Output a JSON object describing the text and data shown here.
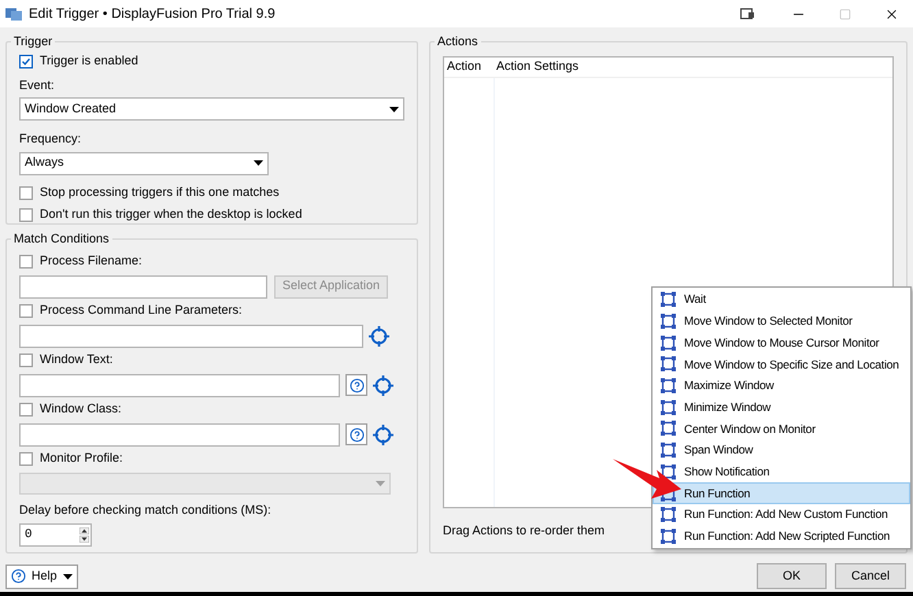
{
  "window": {
    "title": "Edit Trigger • DisplayFusion Pro Trial 9.9"
  },
  "trigger": {
    "legend": "Trigger",
    "enabled": {
      "label": "Trigger is enabled",
      "checked": true
    },
    "event_label": "Event:",
    "event_value": "Window Created",
    "frequency_label": "Frequency:",
    "frequency_value": "Always",
    "options": [
      {
        "label": "Stop processing triggers if this one matches",
        "checked": false
      },
      {
        "label": "Don't run this trigger when the desktop is locked",
        "checked": false
      }
    ]
  },
  "match": {
    "legend": "Match Conditions",
    "conditions": [
      {
        "label": "Process Filename:",
        "checked": false,
        "kind": "app",
        "button": "Select Application"
      },
      {
        "label": "Process Command Line Parameters:",
        "checked": false,
        "kind": "picker"
      },
      {
        "label": "Window Text:",
        "checked": false,
        "kind": "help_picker"
      },
      {
        "label": "Window Class:",
        "checked": false,
        "kind": "help_picker"
      },
      {
        "label": "Monitor Profile:",
        "checked": false,
        "kind": "dropdown"
      }
    ],
    "delay_label": "Delay before checking match conditions (MS):",
    "delay_value": "0"
  },
  "actions": {
    "legend": "Actions",
    "columns": [
      "Action",
      "Action Settings"
    ],
    "hint": "Drag Actions to re-order them"
  },
  "menu": [
    {
      "label": "Wait",
      "selected": false
    },
    {
      "label": "Move Window to Selected Monitor",
      "selected": false
    },
    {
      "label": "Move Window to Mouse Cursor Monitor",
      "selected": false
    },
    {
      "label": "Move Window to Specific Size and Location",
      "selected": false
    },
    {
      "label": "Maximize Window",
      "selected": false
    },
    {
      "label": "Minimize Window",
      "selected": false
    },
    {
      "label": "Center Window on Monitor",
      "selected": false
    },
    {
      "label": "Span Window",
      "selected": false
    },
    {
      "label": "Show Notification",
      "selected": false
    },
    {
      "label": "Run Function",
      "selected": true
    },
    {
      "label": "Run Function: Add New Custom Function",
      "selected": false
    },
    {
      "label": "Run Function: Add New Scripted Function",
      "selected": false
    }
  ],
  "footer": {
    "help": "Help",
    "ok": "OK",
    "cancel": "Cancel"
  }
}
